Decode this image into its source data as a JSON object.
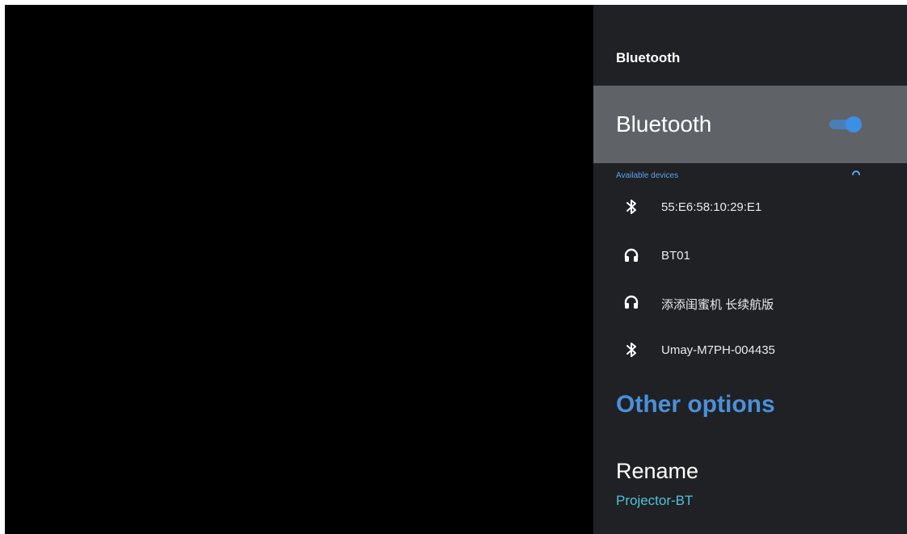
{
  "panel": {
    "title": "Bluetooth",
    "toggle": {
      "label": "Bluetooth",
      "state": "on",
      "accent_color": "#3d8fe6"
    },
    "available_devices": {
      "header": "Available devices",
      "scanning_indicator": "spinner-icon",
      "devices": [
        {
          "icon": "bluetooth-icon",
          "name": "55:E6:58:10:29:E1"
        },
        {
          "icon": "headphones-icon",
          "name": "BT01"
        },
        {
          "icon": "headphones-icon",
          "name": "添添闺蜜机 长续航版"
        },
        {
          "icon": "bluetooth-icon",
          "name": "Umay-M7PH-004435"
        }
      ]
    },
    "other_options": {
      "header": "Other options",
      "rename": {
        "title": "Rename",
        "value": "Projector-BT"
      }
    }
  },
  "colors": {
    "panel_background": "#202124",
    "selected_row": "#5f6368",
    "link_blue": "#4a90d9",
    "rename_value": "#4ec3d9"
  }
}
